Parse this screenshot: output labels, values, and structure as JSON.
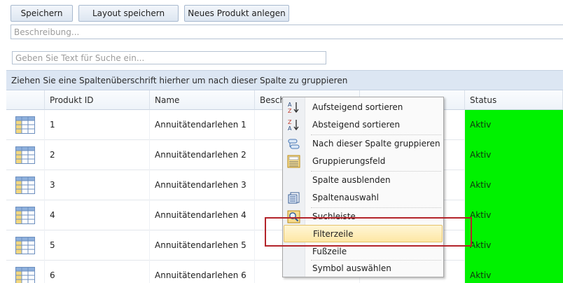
{
  "toolbar": {
    "save_label": "Speichern",
    "save_layout_label": "Layout speichern",
    "new_product_label": "Neues Produkt anlegen"
  },
  "description": {
    "placeholder": "Beschreibung...",
    "value": ""
  },
  "search": {
    "placeholder": "Geben Sie Text für Suche ein...",
    "value": ""
  },
  "group_panel": {
    "text": "Ziehen Sie eine Spaltenüberschrift hierher um nach dieser Spalte zu gruppieren"
  },
  "columns": [
    "",
    "Produkt ID",
    "Name",
    "Besch",
    "",
    "Status"
  ],
  "rows": [
    {
      "id": "1",
      "name": "Annuitätendarlehen 1",
      "status": "Aktiv"
    },
    {
      "id": "2",
      "name": "Annuitätendarlehen 2",
      "status": "Aktiv"
    },
    {
      "id": "3",
      "name": "Annuitätendarlehen 3",
      "status": "Aktiv"
    },
    {
      "id": "4",
      "name": "Annuitätendarlehen 4",
      "status": "Aktiv"
    },
    {
      "id": "5",
      "name": "Annuitätendarlehen 5",
      "status": "Aktiv"
    },
    {
      "id": "6",
      "name": "Annuitätendarlehen 6",
      "status": "Aktiv"
    }
  ],
  "context_menu": {
    "items": [
      {
        "label": "Aufsteigend sortieren",
        "icon": "sort-ascending-icon"
      },
      {
        "label": "Absteigend sortieren",
        "icon": "sort-descending-icon"
      },
      {
        "label": "Nach dieser Spalte gruppieren",
        "icon": "group-by-column-icon"
      },
      {
        "label": "Gruppierungsfeld",
        "icon": "group-panel-icon"
      },
      {
        "label": "Spalte ausblenden",
        "icon": ""
      },
      {
        "label": "Spaltenauswahl",
        "icon": "column-chooser-icon"
      },
      {
        "label": "Suchleiste",
        "icon": "search-panel-icon"
      },
      {
        "label": "Filterzeile",
        "icon": ""
      },
      {
        "label": "Fußzeile",
        "icon": ""
      },
      {
        "label": "Symbol auswählen",
        "icon": ""
      }
    ],
    "highlighted": "Filterzeile"
  },
  "colors": {
    "status_active": "#00f200",
    "group_panel_bg": "#dce6f3",
    "highlight_bg": "#fde7a4",
    "annotation_box": "#b3242a"
  }
}
